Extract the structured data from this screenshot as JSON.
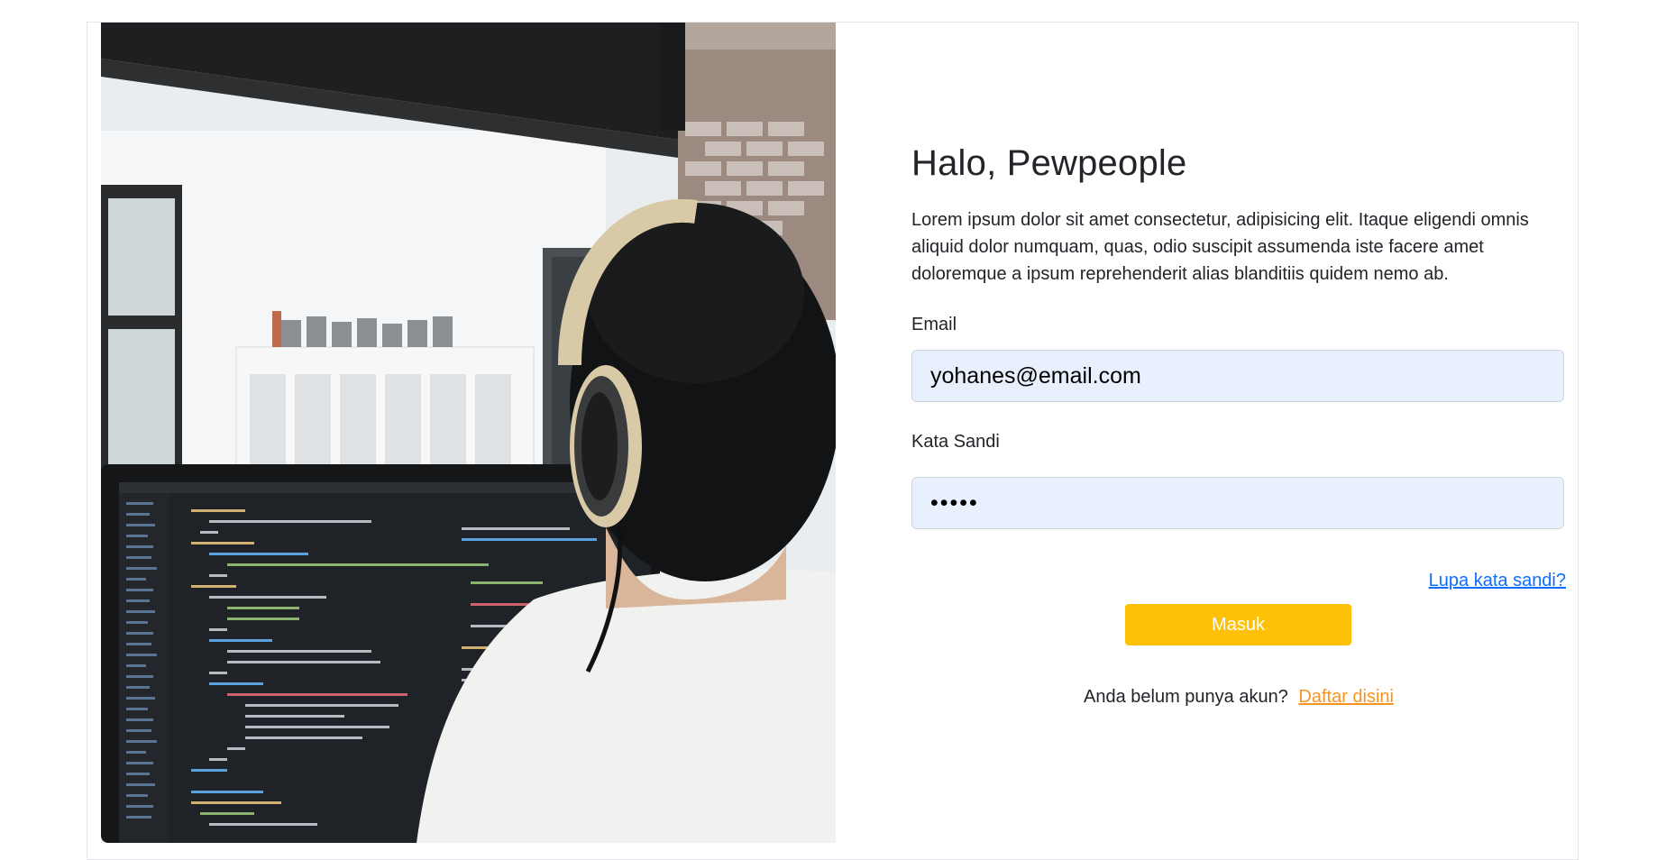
{
  "login": {
    "title": "Halo, Pewpeople",
    "description": "Lorem ipsum dolor sit amet consectetur, adipisicing elit. Itaque eligendi omnis aliquid dolor numquam, quas, odio suscipit assumenda iste facere amet doloremque a ipsum reprehenderit alias blanditiis quidem nemo ab.",
    "email_label": "Email",
    "email_value": "yohanes@email.com",
    "password_label": "Kata Sandi",
    "password_value": "•••••",
    "forgot_link": "Lupa kata sandi?",
    "submit_label": "Masuk",
    "signup_prompt": "Anda belum punya akun?",
    "signup_link": "Daftar disini"
  },
  "colors": {
    "submit_button": "#ffc107",
    "forgot_link": "#0d6efd",
    "signup_link": "#f7941d",
    "input_background": "#e8f0fe"
  },
  "hero_image": {
    "subject": "person-wearing-headphones-coding-at-monitor"
  }
}
